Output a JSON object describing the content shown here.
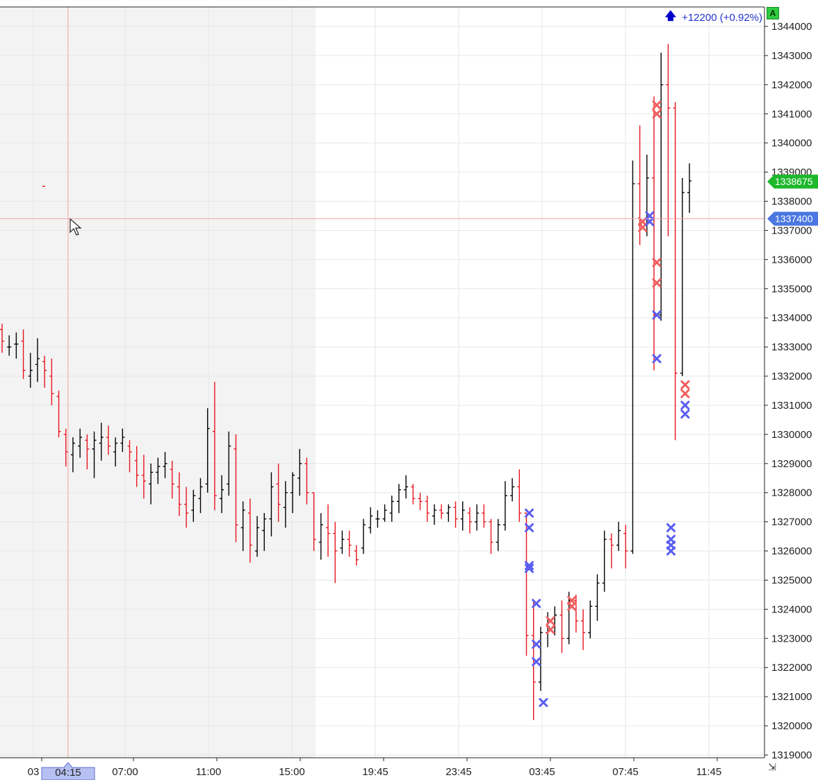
{
  "header": {
    "change_text": "+12200 (+0.92%)",
    "auto_label": "A",
    "change_arrow_icon": "arrow-up-icon",
    "resize_icon": "resize-corner-icon"
  },
  "colors": {
    "up_bar": "#000000",
    "down_bar": "#e8141e",
    "buy_marker": "#5a5ef0",
    "sell_marker": "#f06060",
    "crosshair": "#f3a2a2",
    "session_shade": "#f3f3f3",
    "last_price_bg": "#1db82b",
    "crosshair_price_bg": "#4a77e0"
  },
  "chart_data": {
    "type": "ohlc",
    "y_axis": {
      "range": [
        1319000,
        1344000
      ],
      "ticks": [
        "1344000",
        "1343000",
        "1342000",
        "1341000",
        "1340000",
        "1339000",
        "1338000",
        "1337000",
        "1336000",
        "1335000",
        "1334000",
        "1333000",
        "1332000",
        "1331000",
        "1330000",
        "1329000",
        "1328000",
        "1327000",
        "1326000",
        "1325000",
        "1324000",
        "1323000",
        "1322000",
        "1321000",
        "1320000",
        "1319000"
      ]
    },
    "x_axis": {
      "tick_labels": [
        "03",
        "07:00",
        "11:00",
        "15:00",
        "19:45",
        "23:45",
        "03:45",
        "07:45",
        "11:45"
      ],
      "crosshair_label": "04:15"
    },
    "last_price_label": "1338675",
    "crosshair_price_label": "1337400",
    "crosshair_price": 1337400,
    "grid": true,
    "bars": [
      [
        1333600,
        1333800,
        1332800,
        1333200
      ],
      [
        1333000,
        1333400,
        1332700,
        1333000
      ],
      [
        1333100,
        1333500,
        1332600,
        1333100
      ],
      [
        1333200,
        1333600,
        1331900,
        1332200
      ],
      [
        1332000,
        1332800,
        1331600,
        1332200
      ],
      [
        1332400,
        1333300,
        1331800,
        1332600
      ],
      [
        1332500,
        1332700,
        1331600,
        1332200
      ],
      [
        1332000,
        1332600,
        1331000,
        1331400
      ],
      [
        1331300,
        1331500,
        1329900,
        1330100
      ],
      [
        1330000,
        1330200,
        1328900,
        1329400
      ],
      [
        1329300,
        1329900,
        1328700,
        1329700
      ],
      [
        1329600,
        1330200,
        1329200,
        1329900
      ],
      [
        1329800,
        1330000,
        1328800,
        1329500
      ],
      [
        1329500,
        1330100,
        1328500,
        1329800
      ],
      [
        1329700,
        1330400,
        1329100,
        1329900
      ],
      [
        1329900,
        1330300,
        1329300,
        1329600
      ],
      [
        1329400,
        1329900,
        1328900,
        1329700
      ],
      [
        1329700,
        1330200,
        1329400,
        1329900
      ],
      [
        1329600,
        1329800,
        1328700,
        1329400
      ],
      [
        1329100,
        1329600,
        1328200,
        1328600
      ],
      [
        1328600,
        1329300,
        1327800,
        1328400
      ],
      [
        1328300,
        1329000,
        1327600,
        1328700
      ],
      [
        1328700,
        1329200,
        1328300,
        1328900
      ],
      [
        1328900,
        1329400,
        1328500,
        1329000
      ],
      [
        1328800,
        1329100,
        1327800,
        1328300
      ],
      [
        1328200,
        1328700,
        1327200,
        1327600
      ],
      [
        1327600,
        1328200,
        1326800,
        1327300
      ],
      [
        1327400,
        1328100,
        1327000,
        1327900
      ],
      [
        1327800,
        1328500,
        1327300,
        1328200
      ],
      [
        1328300,
        1330900,
        1328000,
        1330200
      ],
      [
        1330100,
        1331800,
        1327400,
        1327900
      ],
      [
        1327800,
        1328600,
        1327300,
        1328100
      ],
      [
        1328300,
        1330100,
        1327900,
        1329600
      ],
      [
        1329500,
        1330000,
        1326300,
        1326900
      ],
      [
        1326800,
        1327700,
        1326000,
        1327400
      ],
      [
        1327300,
        1327800,
        1325600,
        1326200
      ],
      [
        1326000,
        1327200,
        1325800,
        1326800
      ],
      [
        1326700,
        1327300,
        1326000,
        1327100
      ],
      [
        1327100,
        1328700,
        1326500,
        1328200
      ],
      [
        1328300,
        1329000,
        1327000,
        1327600
      ],
      [
        1327500,
        1328400,
        1326800,
        1328000
      ],
      [
        1328000,
        1328700,
        1327300,
        1328600
      ],
      [
        1328500,
        1329500,
        1327900,
        1329000
      ],
      [
        1329000,
        1329200,
        1327600,
        1328000
      ],
      [
        1328000,
        1328000,
        1326000,
        1326400
      ],
      [
        1326300,
        1327300,
        1325700,
        1326900
      ],
      [
        1326800,
        1327600,
        1325800,
        1326600
      ],
      [
        1326600,
        1327000,
        1324900,
        1326000
      ],
      [
        1326100,
        1326700,
        1325900,
        1326400
      ],
      [
        1326400,
        1326700,
        1325800,
        1326200
      ],
      [
        1326000,
        1326200,
        1325500,
        1325700
      ],
      [
        1326100,
        1327100,
        1325900,
        1326900
      ],
      [
        1326800,
        1327500,
        1326600,
        1327200
      ],
      [
        1327100,
        1327400,
        1326800,
        1327100
      ],
      [
        1327100,
        1327600,
        1327000,
        1327400
      ],
      [
        1327300,
        1327900,
        1327000,
        1327700
      ],
      [
        1327700,
        1328300,
        1327300,
        1328100
      ],
      [
        1328100,
        1328600,
        1327800,
        1328200
      ],
      [
        1328200,
        1328300,
        1327600,
        1327800
      ],
      [
        1327800,
        1328000,
        1327400,
        1327700
      ],
      [
        1327700,
        1327900,
        1327000,
        1327300
      ],
      [
        1327200,
        1327600,
        1326900,
        1327400
      ],
      [
        1327400,
        1327600,
        1327100,
        1327300
      ],
      [
        1327300,
        1327600,
        1327000,
        1327500
      ],
      [
        1327500,
        1327700,
        1326800,
        1327100
      ],
      [
        1327100,
        1327700,
        1326700,
        1327400
      ],
      [
        1327300,
        1327500,
        1326600,
        1327000
      ],
      [
        1327000,
        1327600,
        1326700,
        1327300
      ],
      [
        1327300,
        1327600,
        1326800,
        1327000
      ],
      [
        1327000,
        1327100,
        1325900,
        1326300
      ],
      [
        1326300,
        1327100,
        1326000,
        1326900
      ],
      [
        1326900,
        1328400,
        1326700,
        1327900
      ],
      [
        1327900,
        1328500,
        1327700,
        1328200
      ],
      [
        1328200,
        1328800,
        1327000,
        1327300
      ],
      [
        1327300,
        1327300,
        1322400,
        1323100
      ],
      [
        1323100,
        1324300,
        1320200,
        1321500
      ],
      [
        1321500,
        1323400,
        1321200,
        1323200
      ],
      [
        1323200,
        1323900,
        1322700,
        1323400
      ],
      [
        1323400,
        1324100,
        1323100,
        1323800
      ],
      [
        1323800,
        1324300,
        1322500,
        1323000
      ],
      [
        1323000,
        1324600,
        1322800,
        1324300
      ],
      [
        1324300,
        1324500,
        1323200,
        1323600
      ],
      [
        1323600,
        1324000,
        1322600,
        1323200
      ],
      [
        1323200,
        1324300,
        1323000,
        1324100
      ],
      [
        1324100,
        1325200,
        1323600,
        1324900
      ],
      [
        1324900,
        1326700,
        1324600,
        1326400
      ],
      [
        1326400,
        1326600,
        1325400,
        1326200
      ],
      [
        1326200,
        1327000,
        1326000,
        1326700
      ],
      [
        1326600,
        1326900,
        1325400,
        1326000
      ],
      [
        1326000,
        1339400,
        1325900,
        1338600
      ],
      [
        1338600,
        1340600,
        1336500,
        1337200
      ],
      [
        1337200,
        1339600,
        1336800,
        1338800
      ],
      [
        1338800,
        1341600,
        1332200,
        1334100
      ],
      [
        1334100,
        1343100,
        1333900,
        1342000
      ],
      [
        1342000,
        1343400,
        1336800,
        1341200
      ],
      [
        1341200,
        1341400,
        1329800,
        1332100
      ],
      [
        1332100,
        1338800,
        1332000,
        1338300
      ],
      [
        1338300,
        1339300,
        1337600,
        1338700
      ]
    ],
    "trade_markers": [
      {
        "bar": 74,
        "side": "buy",
        "prices": [
          1327300,
          1326800
        ]
      },
      {
        "bar": 74,
        "side": "buy",
        "prices": [
          1325500,
          1325400
        ]
      },
      {
        "bar": 75,
        "side": "buy",
        "prices": [
          1324200
        ]
      },
      {
        "bar": 75,
        "side": "buy",
        "prices": [
          1322800,
          1322200
        ]
      },
      {
        "bar": 76,
        "side": "buy",
        "prices": [
          1320800
        ]
      },
      {
        "bar": 77,
        "side": "sell",
        "prices": [
          1323600,
          1323300
        ]
      },
      {
        "bar": 80,
        "side": "sell",
        "prices": [
          1324300,
          1324100
        ]
      },
      {
        "bar": 90,
        "side": "sell",
        "prices": [
          1337300,
          1337100
        ]
      },
      {
        "bar": 91,
        "side": "buy",
        "prices": [
          1337300,
          1337500
        ]
      },
      {
        "bar": 92,
        "side": "sell",
        "prices": [
          1341300,
          1341000
        ]
      },
      {
        "bar": 92,
        "side": "sell",
        "prices": [
          1335900,
          1335200
        ]
      },
      {
        "bar": 92,
        "side": "buy",
        "prices": [
          1334100,
          1332600
        ]
      },
      {
        "bar": 94,
        "side": "buy",
        "prices": [
          1326800,
          1326400,
          1326200,
          1326000
        ]
      },
      {
        "bar": 96,
        "side": "sell",
        "prices": [
          1331700,
          1331400
        ]
      },
      {
        "bar": 96,
        "side": "buy",
        "prices": [
          1331000,
          1330700
        ]
      }
    ]
  }
}
